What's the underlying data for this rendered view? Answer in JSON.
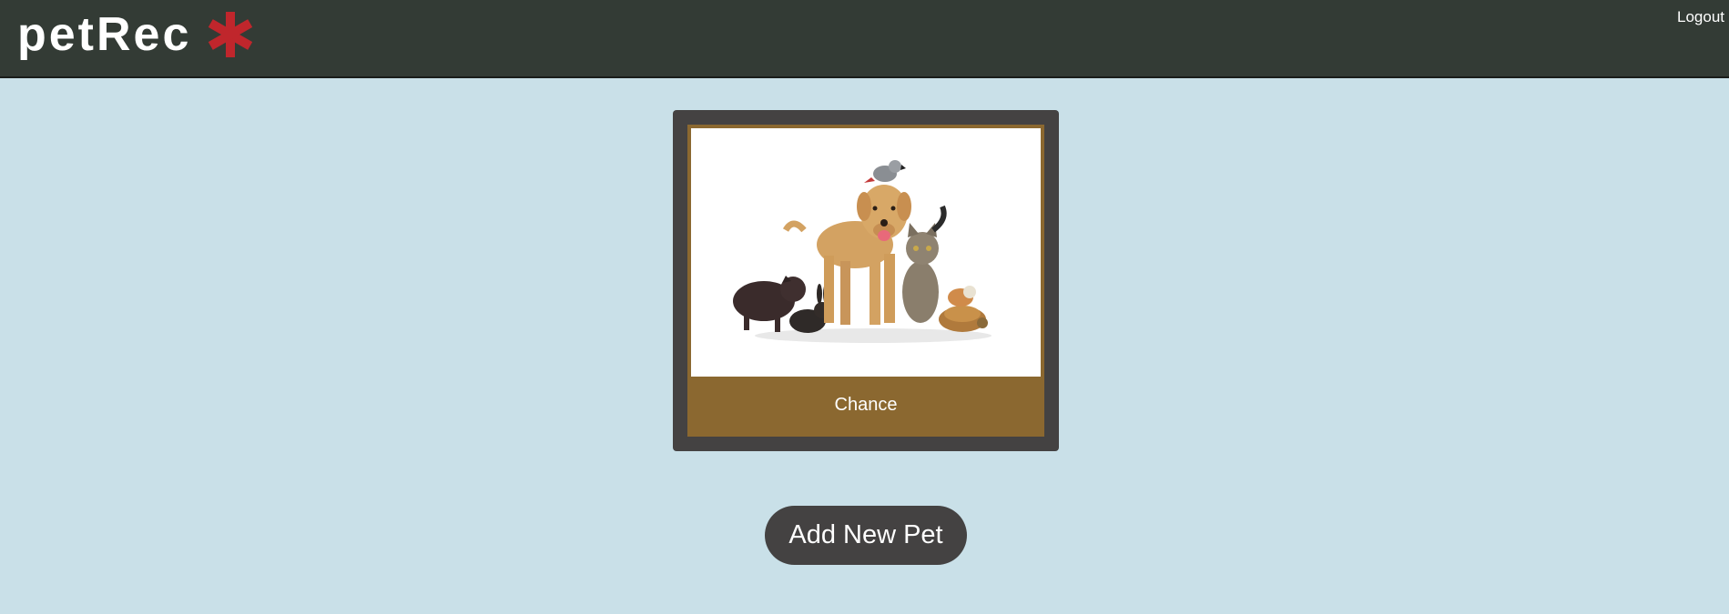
{
  "header": {
    "logo_text": "petRec",
    "logo_icon": "asterisk-icon",
    "logout_label": "Logout"
  },
  "pets": [
    {
      "name": "Chance",
      "photo_icon": "pets-group-photo"
    }
  ],
  "actions": {
    "add_pet_label": "Add New Pet"
  },
  "colors": {
    "background": "#c9e0e8",
    "header": "#333b35",
    "accent_red": "#c0262c",
    "card_frame": "#444242",
    "card_inner": "#8b6830",
    "button": "#444242"
  }
}
